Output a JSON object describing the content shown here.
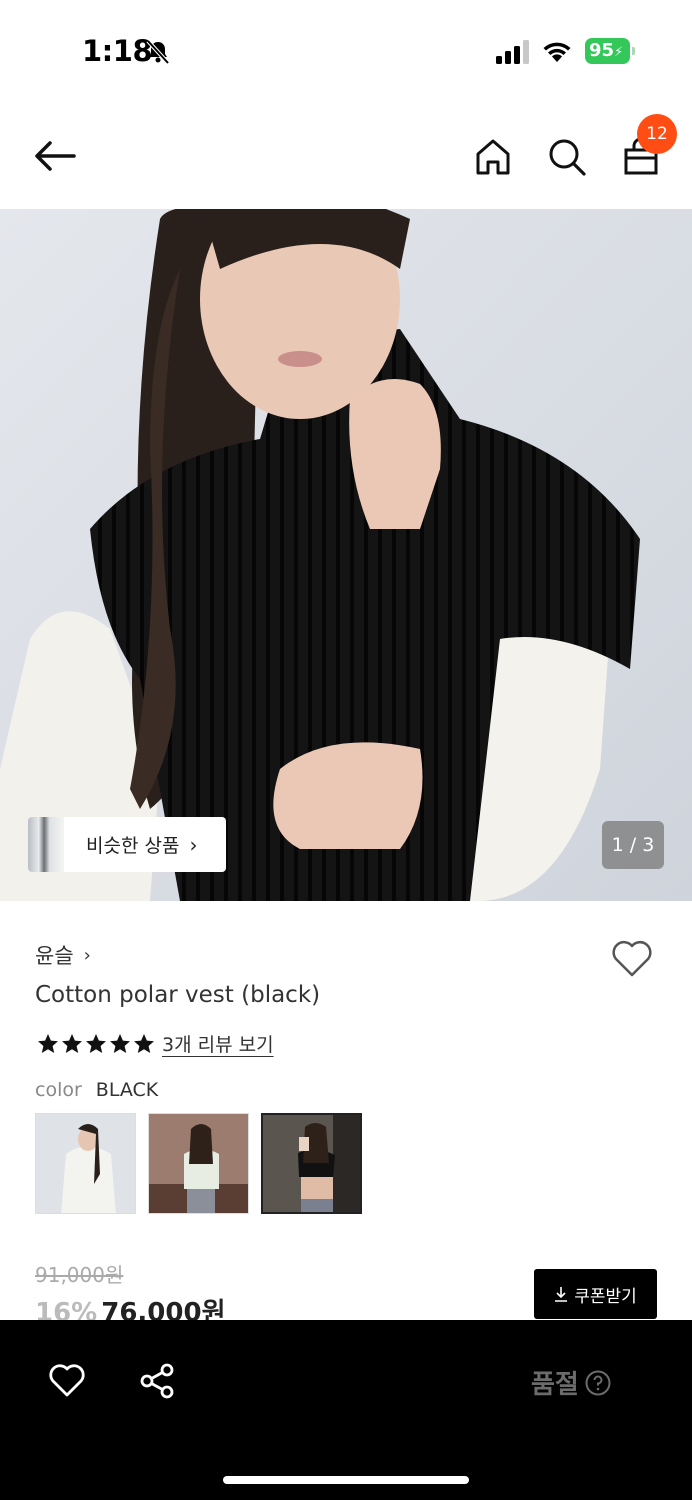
{
  "status_bar": {
    "time": "1:18",
    "battery": "95"
  },
  "header": {
    "cart_count": "12",
    "icons": [
      "back-arrow-icon",
      "home-icon",
      "search-icon",
      "shopping-bag-icon"
    ]
  },
  "gallery": {
    "similar_button_label": "비슷한 상품",
    "page_indicator": "1 / 3",
    "current_page": 1,
    "total_pages": 3
  },
  "product": {
    "brand": "윤슬",
    "name": "Cotton polar vest (black)",
    "rating_stars": 5,
    "review_link": "3개 리뷰 보기",
    "color_label": "color",
    "color_value": "BLACK",
    "swatch_count": 3,
    "selected_swatch": 3,
    "original_price": "91,000원",
    "discount_rate": "16%",
    "sale_price": "76,000원",
    "coupon_button": "쿠폰받기"
  },
  "bottom_bar": {
    "status_label": "품절"
  },
  "colors": {
    "badge": "#ff4d14",
    "battery": "#34c759",
    "bottom_bar": "#000000",
    "star": "#111111"
  }
}
